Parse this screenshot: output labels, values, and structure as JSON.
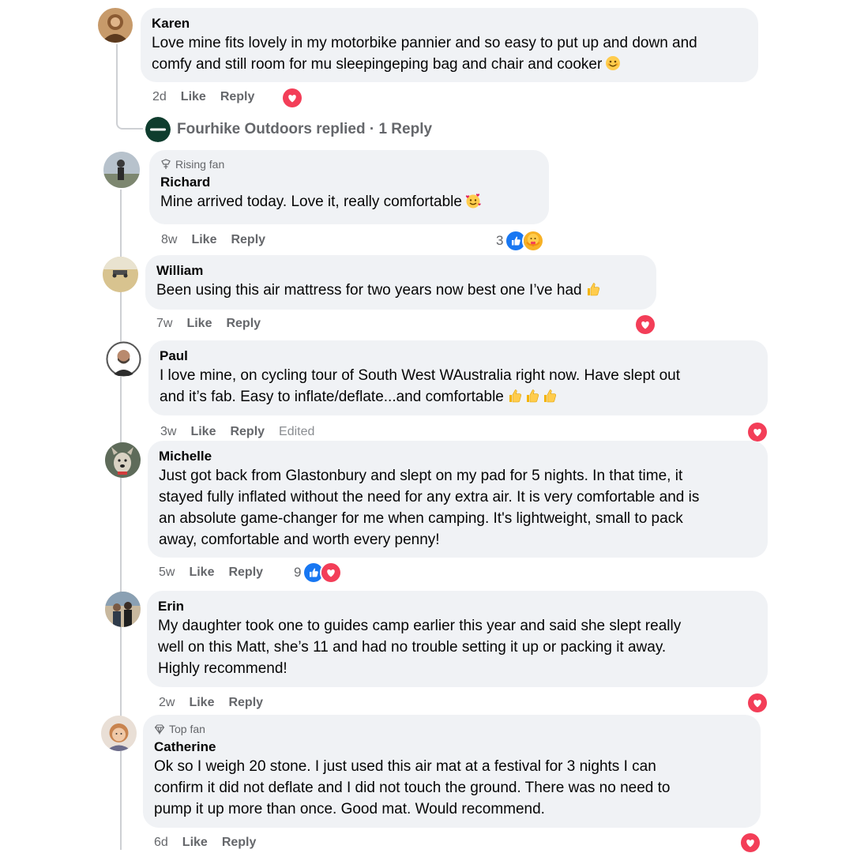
{
  "actions": {
    "like": "Like",
    "reply": "Reply",
    "edited": "Edited"
  },
  "colors": {
    "bubble": "#f0f2f5",
    "meta_text": "#65676b",
    "love": "#f33e58",
    "like": "#1877f2",
    "thread_line": "#ced0d4"
  },
  "comments": [
    {
      "name": "Karen",
      "lines": [
        "Love mine fits lovely in my motorbike pannier and so easy to put up and down and",
        "comfy and still room for mu sleepingeping bag and chair and cooker"
      ],
      "emoji": "smiling-face-emoji",
      "time": "2d",
      "reactions": [
        "love"
      ]
    },
    {
      "badge": "Rising fan",
      "badge_icon": "rising-fan-icon",
      "name": "Richard",
      "lines": [
        "Mine arrived today. Love it, really comfortable"
      ],
      "emoji": "smiling-face-with-hearts-emoji",
      "time": "8w",
      "reaction_count": "3",
      "reactions": [
        "like",
        "care"
      ]
    },
    {
      "name": "William",
      "lines": [
        "Been using this air mattress for two years now best one I’ve had"
      ],
      "emoji": "thumbs-up-emoji",
      "time": "7w",
      "reactions": [
        "love"
      ]
    },
    {
      "name": "Paul",
      "lines": [
        "I love mine, on cycling tour of South West WAustralia right now. Have slept out",
        "and it’s fab. Easy to inflate/deflate...and comfortable"
      ],
      "emoji": "thumbs-up-emoji x3",
      "time": "3w",
      "edited": true,
      "reactions": [
        "love"
      ]
    },
    {
      "name": "Michelle",
      "lines": [
        "Just got back from Glastonbury and slept on my pad for 5 nights. In that time, it",
        "stayed fully inflated without the need for any extra air. It is very comfortable and is",
        "an absolute game-changer for me when camping. It's lightweight, small to pack",
        "away, comfortable and worth every penny!"
      ],
      "time": "5w",
      "reaction_count": "9",
      "reactions": [
        "like",
        "love"
      ]
    },
    {
      "name": "Erin",
      "lines": [
        "My daughter took one to guides camp earlier this year and said she slept really",
        "well on this Matt, she’s 11 and had no trouble setting it up or packing it away.",
        "Highly recommend!"
      ],
      "time": "2w",
      "reactions": [
        "love"
      ]
    },
    {
      "badge": "Top fan",
      "badge_icon": "top-fan-diamond-icon",
      "name": "Catherine",
      "lines": [
        "Ok so I weigh 20 stone. I just used this air mat at a festival for 3 nights I can",
        "confirm it did not deflate and I did not touch the ground. There was no need to",
        "pump it up more than once. Good mat. Would recommend."
      ],
      "time": "6d",
      "reactions": [
        "love"
      ]
    }
  ],
  "reply_summary": {
    "text": "Fourhike Outdoors replied · 1 Reply",
    "avatar_icon": "fourhike-logo-avatar"
  }
}
